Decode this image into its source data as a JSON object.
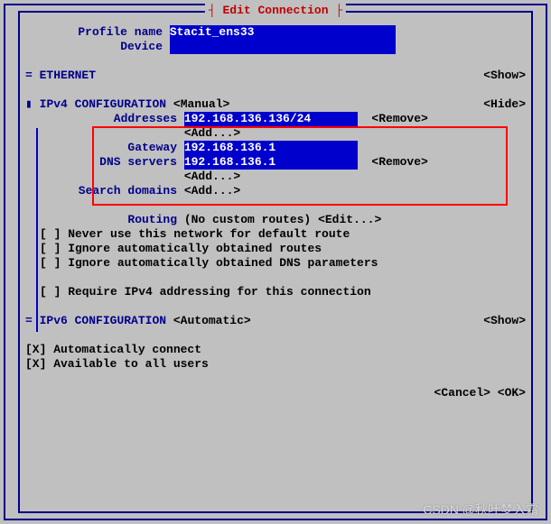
{
  "title": "Edit Connection",
  "profile": {
    "name_label": "Profile name",
    "name_value": "Stacit_ens33",
    "device_label": "Device",
    "device_value": ""
  },
  "ethernet": {
    "marker": "=",
    "label": "ETHERNET",
    "action": "<Show>"
  },
  "ipv4": {
    "bullet": "▮",
    "label": "IPv4 CONFIGURATION",
    "mode": "<Manual>",
    "hide": "<Hide>",
    "addresses_label": "Addresses",
    "addresses_value": "192.168.136.136/24",
    "addresses_remove": "<Remove>",
    "addresses_add": "<Add...>",
    "gateway_label": "Gateway",
    "gateway_value": "192.168.136.1",
    "dns_label": "DNS servers",
    "dns_value": "192.168.136.1",
    "dns_remove": "<Remove>",
    "dns_add": "<Add...>",
    "search_label": "Search domains",
    "search_add": "<Add...>",
    "routing_label": "Routing",
    "routing_value": "(No custom routes)",
    "routing_edit": "<Edit...>",
    "cb1": "[ ] Never use this network for default route",
    "cb2": "[ ] Ignore automatically obtained routes",
    "cb3": "[ ] Ignore automatically obtained DNS parameters",
    "cb4": "[ ] Require IPv4 addressing for this connection"
  },
  "ipv6": {
    "marker": "=",
    "label": "IPv6 CONFIGURATION",
    "mode": "<Automatic>",
    "action": "<Show>"
  },
  "auto_connect": "[X] Automatically connect",
  "avail_all": "[X] Available to all users",
  "footer": {
    "cancel": "<Cancel>",
    "ok": "<OK>"
  },
  "watermark": "CSDN @秋叶梦入霜"
}
